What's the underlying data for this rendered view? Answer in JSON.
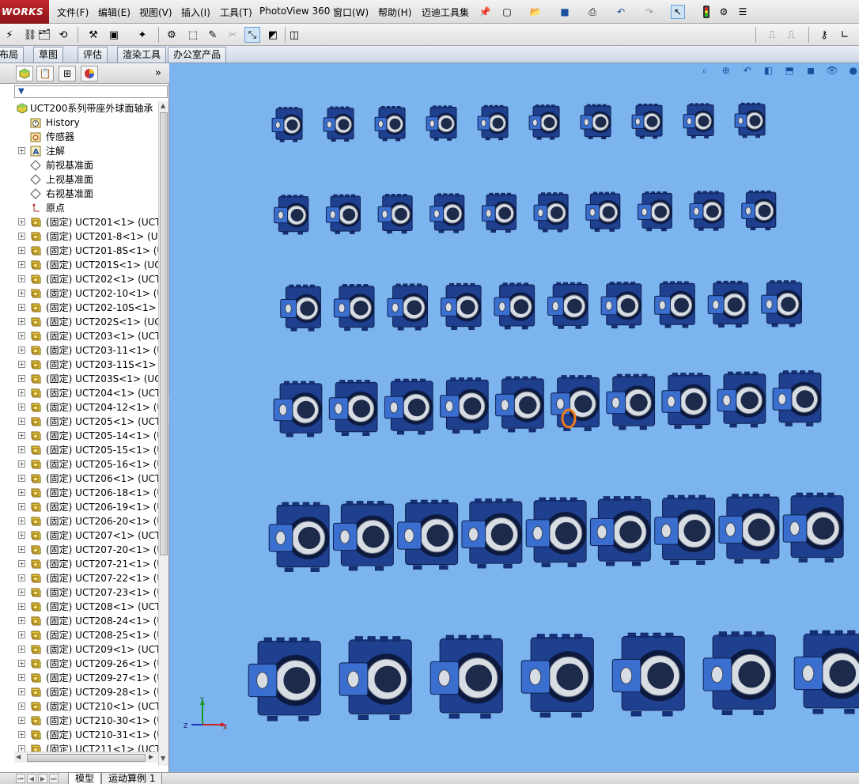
{
  "app": {
    "logo_text": "WORKS"
  },
  "menu": {
    "items": [
      "文件(F)",
      "编辑(E)",
      "视图(V)",
      "插入(I)",
      "工具(T)",
      "PhotoView 360",
      "窗口(W)",
      "帮助(H)",
      "迈迪工具集"
    ]
  },
  "command_tabs": [
    "布局",
    "草图",
    "评估",
    "渲染工具",
    "办公室产品"
  ],
  "feature_tree": {
    "root": "UCT200系列带座外球面轴承",
    "items": [
      {
        "label": "History",
        "icon": "history-icon",
        "expandable": false
      },
      {
        "label": "传感器",
        "icon": "sensor-icon",
        "expandable": false
      },
      {
        "label": "注解",
        "icon": "annotation-icon",
        "expandable": true
      },
      {
        "label": "前视基准面",
        "icon": "plane-icon",
        "expandable": false
      },
      {
        "label": "上视基准面",
        "icon": "plane-icon",
        "expandable": false
      },
      {
        "label": "右视基准面",
        "icon": "plane-icon",
        "expandable": false
      },
      {
        "label": "原点",
        "icon": "origin-icon",
        "expandable": false
      },
      {
        "label": "(固定) UCT201<1> (UCT2",
        "icon": "component-icon",
        "expandable": true
      },
      {
        "label": "(固定) UCT201-8<1> (UC",
        "icon": "component-icon",
        "expandable": true
      },
      {
        "label": "(固定) UCT201-8S<1> (U",
        "icon": "component-icon",
        "expandable": true
      },
      {
        "label": "(固定) UCT201S<1> (UCT",
        "icon": "component-icon",
        "expandable": true
      },
      {
        "label": "(固定) UCT202<1> (UCT2",
        "icon": "component-icon",
        "expandable": true
      },
      {
        "label": "(固定) UCT202-10<1> (U",
        "icon": "component-icon",
        "expandable": true
      },
      {
        "label": "(固定) UCT202-10S<1> (",
        "icon": "component-icon",
        "expandable": true
      },
      {
        "label": "(固定) UCT202S<1> (UCT",
        "icon": "component-icon",
        "expandable": true
      },
      {
        "label": "(固定) UCT203<1> (UCT2",
        "icon": "component-icon",
        "expandable": true
      },
      {
        "label": "(固定) UCT203-11<1> (U",
        "icon": "component-icon",
        "expandable": true
      },
      {
        "label": "(固定) UCT203-11S<1> (",
        "icon": "component-icon",
        "expandable": true
      },
      {
        "label": "(固定) UCT203S<1> (UCT",
        "icon": "component-icon",
        "expandable": true
      },
      {
        "label": "(固定) UCT204<1> (UCT2",
        "icon": "component-icon",
        "expandable": true
      },
      {
        "label": "(固定) UCT204-12<1> (U",
        "icon": "component-icon",
        "expandable": true
      },
      {
        "label": "(固定) UCT205<1> (UCT2",
        "icon": "component-icon",
        "expandable": true
      },
      {
        "label": "(固定) UCT205-14<1> (U",
        "icon": "component-icon",
        "expandable": true
      },
      {
        "label": "(固定) UCT205-15<1> (U",
        "icon": "component-icon",
        "expandable": true
      },
      {
        "label": "(固定) UCT205-16<1> (U",
        "icon": "component-icon",
        "expandable": true
      },
      {
        "label": "(固定) UCT206<1> (UCT2",
        "icon": "component-icon",
        "expandable": true
      },
      {
        "label": "(固定) UCT206-18<1> (U",
        "icon": "component-icon",
        "expandable": true
      },
      {
        "label": "(固定) UCT206-19<1> (U",
        "icon": "component-icon",
        "expandable": true
      },
      {
        "label": "(固定) UCT206-20<1> (U",
        "icon": "component-icon",
        "expandable": true
      },
      {
        "label": "(固定) UCT207<1> (UCT2",
        "icon": "component-icon",
        "expandable": true
      },
      {
        "label": "(固定) UCT207-20<1> (U",
        "icon": "component-icon",
        "expandable": true
      },
      {
        "label": "(固定) UCT207-21<1> (U",
        "icon": "component-icon",
        "expandable": true
      },
      {
        "label": "(固定) UCT207-22<1> (U",
        "icon": "component-icon",
        "expandable": true
      },
      {
        "label": "(固定) UCT207-23<1> (U",
        "icon": "component-icon",
        "expandable": true
      },
      {
        "label": "(固定) UCT208<1> (UCT2",
        "icon": "component-icon",
        "expandable": true
      },
      {
        "label": "(固定) UCT208-24<1> (U",
        "icon": "component-icon",
        "expandable": true
      },
      {
        "label": "(固定) UCT208-25<1> (U",
        "icon": "component-icon",
        "expandable": true
      },
      {
        "label": "(固定) UCT209<1> (UCT2",
        "icon": "component-icon",
        "expandable": true
      },
      {
        "label": "(固定) UCT209-26<1> (U",
        "icon": "component-icon",
        "expandable": true
      },
      {
        "label": "(固定) UCT209-27<1> (U",
        "icon": "component-icon",
        "expandable": true
      },
      {
        "label": "(固定) UCT209-28<1> (U",
        "icon": "component-icon",
        "expandable": true
      },
      {
        "label": "(固定) UCT210<1> (UCT2",
        "icon": "component-icon",
        "expandable": true
      },
      {
        "label": "(固定) UCT210-30<1> (U",
        "icon": "component-icon",
        "expandable": true
      },
      {
        "label": "(固定) UCT210-31<1> (U",
        "icon": "component-icon",
        "expandable": true
      },
      {
        "label": "(固定) UCT211<1> (UCT2",
        "icon": "component-icon",
        "expandable": true
      }
    ]
  },
  "triad": {
    "x_label": "X",
    "y_label": "Y",
    "z_label": "Z"
  },
  "bottom_tabs": [
    "模型",
    "运动算例 1"
  ],
  "colors": {
    "viewport_bg": "#7cb4f0",
    "part_body": "#1f3f8f",
    "part_face": "#3a6fd0",
    "bore_steel": "#d8dde3",
    "selection": "#f07a1a"
  }
}
